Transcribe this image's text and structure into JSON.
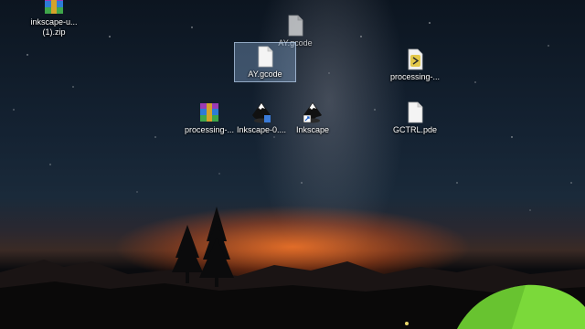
{
  "desktop": {
    "icons": [
      {
        "id": "inkscape-zip",
        "label": "inkscape-u...\n(1).zip",
        "type": "winrar-archive"
      },
      {
        "id": "ay-gcode-drag",
        "label": "AY.gcode",
        "type": "document"
      },
      {
        "id": "ay-gcode",
        "label": "AY.gcode",
        "type": "document",
        "selected": true
      },
      {
        "id": "processing-folder",
        "label": "processing-...",
        "type": "processing-app"
      },
      {
        "id": "processing-zip",
        "label": "processing-...",
        "type": "winrar-archive"
      },
      {
        "id": "inkscape-installer",
        "label": "Inkscape-0....",
        "type": "inkscape-app"
      },
      {
        "id": "inkscape-shortcut",
        "label": "Inkscape",
        "type": "inkscape-shortcut"
      },
      {
        "id": "gctrl-pde",
        "label": "GCTRL.pde",
        "type": "document"
      }
    ]
  },
  "colors": {
    "sky_top": "#0c1520",
    "horizon_glow": "#ff7828",
    "tent_green": "#7bd93a",
    "selection": "#96b9e6"
  }
}
